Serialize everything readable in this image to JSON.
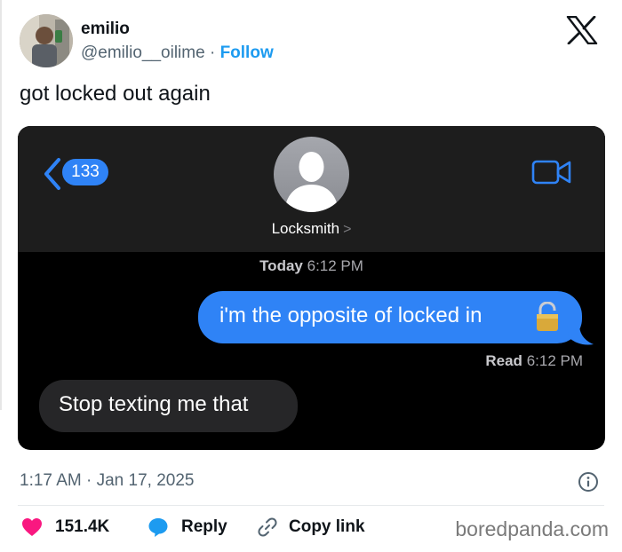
{
  "author": {
    "name": "emilio",
    "handle": "@emilio__oilime",
    "separator": "·",
    "follow_label": "Follow"
  },
  "tweet": {
    "text": "got locked out again"
  },
  "screenshot": {
    "back_badge_count": "133",
    "contact_name": "Locksmith",
    "contact_chevron": ">",
    "timestamp_day": "Today",
    "timestamp_time": "6:12 PM",
    "sent_message": "i'm the opposite of locked in",
    "sent_emoji_icon": "unlocked-padlock-icon",
    "read_label": "Read",
    "read_time": "6:12 PM",
    "received_message": "Stop texting me that",
    "colors": {
      "sent_bubble": "#2f83f6",
      "received_bubble": "#262628",
      "background": "#000000",
      "header": "#1d1d1d"
    }
  },
  "footer": {
    "post_time": "1:17 AM · Jan 17, 2025",
    "like_count": "151.4K",
    "reply_label": "Reply",
    "copy_link_label": "Copy link",
    "watermark": "boredpanda.com",
    "colors": {
      "like": "#f91880",
      "reply": "#1d9bf0",
      "link": "#1d9bf0"
    }
  }
}
